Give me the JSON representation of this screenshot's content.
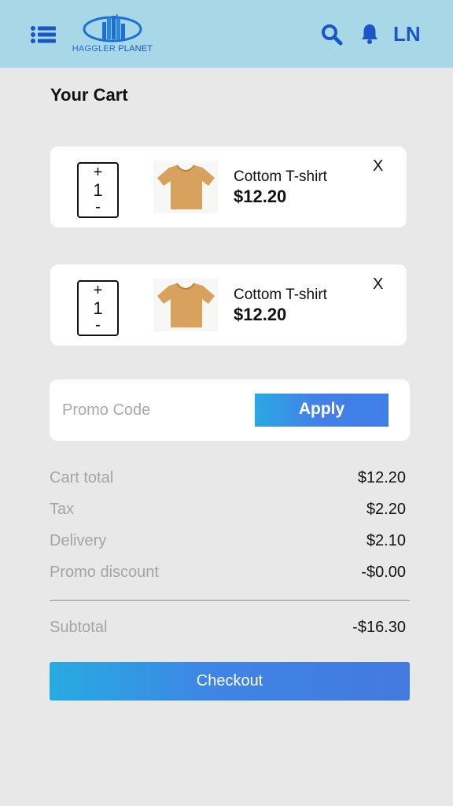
{
  "header": {
    "logo_text_1": "HAGGLER",
    "logo_text_2": "PLANET",
    "menu_icon": "menu-list-icon",
    "search_icon": "search-icon",
    "bell_icon": "bell-icon",
    "user_initials": "LN",
    "accent": "#1a56c6",
    "background": "#a8d8e8"
  },
  "page": {
    "title": "Your Cart"
  },
  "cart_items": [
    {
      "name": "Cottom T-shirt",
      "price": "$12.20",
      "quantity": "1",
      "plus": "+",
      "minus": "-",
      "remove": "X",
      "image": "tshirt-image"
    },
    {
      "name": "Cottom T-shirt",
      "price": "$12.20",
      "quantity": "1",
      "plus": "+",
      "minus": "-",
      "remove": "X",
      "image": "tshirt-image"
    }
  ],
  "promo": {
    "placeholder": "Promo Code",
    "apply_label": "Apply"
  },
  "summary": {
    "cart_total_label": "Cart total",
    "cart_total_value": "$12.20",
    "tax_label": "Tax",
    "tax_value": "$2.20",
    "delivery_label": "Delivery",
    "delivery_value": "$2.10",
    "promo_discount_label": "Promo discount",
    "promo_discount_value": "-$0.00",
    "subtotal_label": "Subtotal",
    "subtotal_value": "-$16.30"
  },
  "checkout": {
    "label": "Checkout"
  }
}
